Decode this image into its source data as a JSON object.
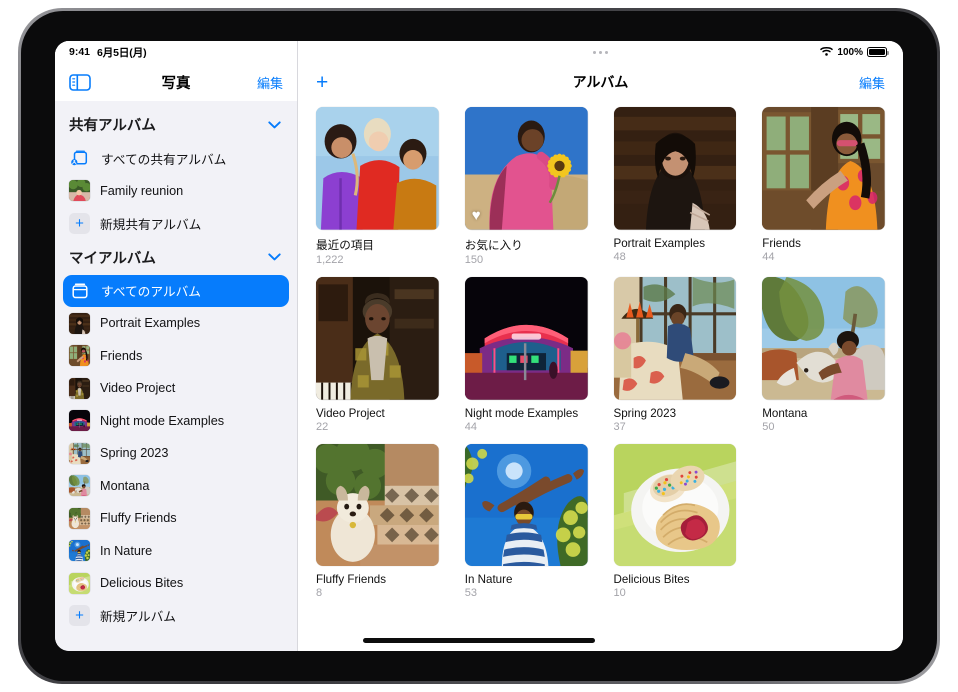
{
  "status_bar": {
    "time": "9:41",
    "date": "6月5日(月)",
    "wifi_icon": "wifi-icon",
    "battery_percent": "100%",
    "battery_icon": "battery-full-icon"
  },
  "sidebar": {
    "toggle_icon": "sidebar-toggle-icon",
    "title": "写真",
    "edit_label": "編集",
    "sections": [
      {
        "name": "shared-albums",
        "header": "共有アルバム",
        "chevron_icon": "chevron-down-icon",
        "items": [
          {
            "label": "すべての共有アルバム",
            "icon": "shared-album-icon",
            "kind": "glyph",
            "selected": false
          },
          {
            "label": "Family reunion",
            "icon": "album-thumbnail",
            "kind": "thumb",
            "thumb": "family-reunion",
            "selected": false
          },
          {
            "label": "新規共有アルバム",
            "icon": "plus-icon",
            "kind": "plus",
            "selected": false
          }
        ]
      },
      {
        "name": "my-albums",
        "header": "マイアルバム",
        "chevron_icon": "chevron-down-icon",
        "items": [
          {
            "label": "すべてのアルバム",
            "icon": "albums-stack-icon",
            "kind": "glyph",
            "selected": true
          },
          {
            "label": "Portrait Examples",
            "icon": "album-thumbnail",
            "kind": "thumb",
            "thumb": "portrait",
            "selected": false
          },
          {
            "label": "Friends",
            "icon": "album-thumbnail",
            "kind": "thumb",
            "thumb": "friends",
            "selected": false
          },
          {
            "label": "Video Project",
            "icon": "album-thumbnail",
            "kind": "thumb",
            "thumb": "video",
            "selected": false
          },
          {
            "label": "Night mode Examples",
            "icon": "album-thumbnail",
            "kind": "thumb",
            "thumb": "night",
            "selected": false
          },
          {
            "label": "Spring 2023",
            "icon": "album-thumbnail",
            "kind": "thumb",
            "thumb": "spring",
            "selected": false
          },
          {
            "label": "Montana",
            "icon": "album-thumbnail",
            "kind": "thumb",
            "thumb": "montana",
            "selected": false
          },
          {
            "label": "Fluffy Friends",
            "icon": "album-thumbnail",
            "kind": "thumb",
            "thumb": "fluffy",
            "selected": false
          },
          {
            "label": "In Nature",
            "icon": "album-thumbnail",
            "kind": "thumb",
            "thumb": "nature",
            "selected": false
          },
          {
            "label": "Delicious Bites",
            "icon": "album-thumbnail",
            "kind": "thumb",
            "thumb": "bites",
            "selected": false
          },
          {
            "label": "新規アルバム",
            "icon": "plus-icon",
            "kind": "plus",
            "selected": false
          }
        ]
      }
    ]
  },
  "main": {
    "add_icon": "plus-icon",
    "title": "アルバム",
    "edit_label": "編集",
    "albums": [
      {
        "name": "最近の項目",
        "count": "1,222",
        "cover": "recents",
        "favorite": false
      },
      {
        "name": "お気に入り",
        "count": "150",
        "cover": "favorites",
        "favorite": true
      },
      {
        "name": "Portrait Examples",
        "count": "48",
        "cover": "portrait",
        "favorite": false
      },
      {
        "name": "Friends",
        "count": "44",
        "cover": "friends",
        "favorite": false
      },
      {
        "name": "Video Project",
        "count": "22",
        "cover": "video",
        "favorite": false
      },
      {
        "name": "Night mode Examples",
        "count": "44",
        "cover": "night",
        "favorite": false
      },
      {
        "name": "Spring 2023",
        "count": "37",
        "cover": "spring",
        "favorite": false
      },
      {
        "name": "Montana",
        "count": "50",
        "cover": "montana",
        "favorite": false
      },
      {
        "name": "Fluffy Friends",
        "count": "8",
        "cover": "fluffy",
        "favorite": false
      },
      {
        "name": "In Nature",
        "count": "53",
        "cover": "nature",
        "favorite": false
      },
      {
        "name": "Delicious Bites",
        "count": "10",
        "cover": "bites",
        "favorite": false
      }
    ]
  },
  "home_indicator": "home-indicator",
  "colors": {
    "accent": "#067cfc",
    "sidebar_bg": "#f2f2f7",
    "secondary_text": "#a3a3a9"
  }
}
